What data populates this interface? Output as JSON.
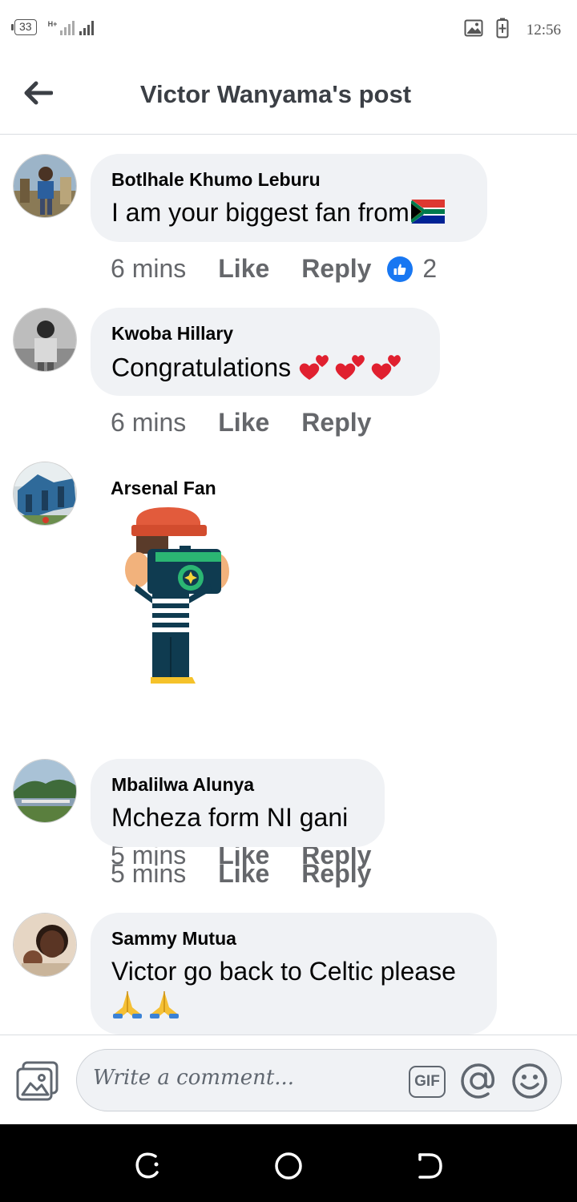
{
  "status_bar": {
    "battery_level": "33",
    "network": "H+",
    "time": "12:56",
    "icons": [
      "image-icon",
      "battery-charging-icon"
    ]
  },
  "header": {
    "title": "Victor Wanyama's post",
    "back_icon": "arrow-left-icon"
  },
  "comments": [
    {
      "author": "Botlhale Khumo Leburu",
      "text": "I am your biggest fan from",
      "emoji": "flag-south-africa",
      "time": "6 mins",
      "like_label": "Like",
      "reply_label": "Reply",
      "reaction": "like",
      "reaction_count": "2"
    },
    {
      "author": "Kwoba Hillary",
      "text": "Congratulations ",
      "emoji": "two-hearts x3",
      "time": "6 mins",
      "like_label": "Like",
      "reply_label": "Reply"
    },
    {
      "author": "Arsenal Fan",
      "attachment": "sticker-photographer",
      "time": "5 mins",
      "like_label": "Like",
      "reply_label": "Reply"
    },
    {
      "author": "Mbalilwa Alunya",
      "text": "Mcheza form NI gani",
      "time": "5 mins",
      "like_label": "Like",
      "reply_label": "Reply"
    },
    {
      "author": "Sammy Mutua",
      "text": "Victor go back to Celtic please",
      "emoji": "folded-hands x2"
    }
  ],
  "composer": {
    "placeholder": "Write a comment...",
    "gif_label": "GIF",
    "icons": [
      "photo-icon",
      "at-icon",
      "emoji-icon"
    ]
  },
  "navigation_bar": {
    "icons": [
      "recents-icon",
      "home-icon",
      "back-icon"
    ]
  },
  "colors": {
    "bubble": "#f0f2f5",
    "meta_text": "#65676b",
    "like_blue": "#1877f2",
    "divider": "#dadde1"
  }
}
